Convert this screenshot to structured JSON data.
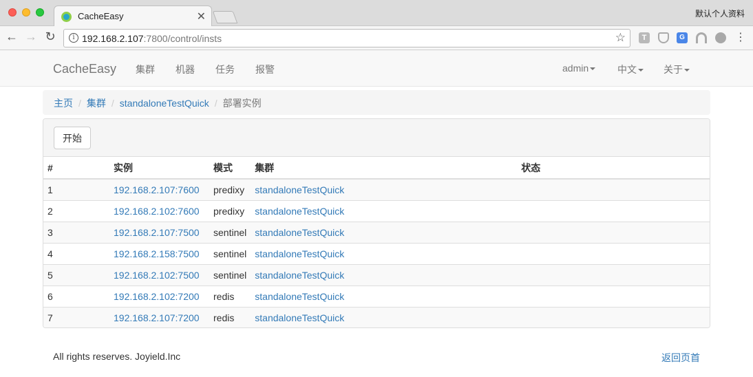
{
  "browser": {
    "tab_title": "CacheEasy",
    "tab_close": "✕",
    "profile": "默认个人资料",
    "url_host": "192.168.2.107",
    "url_rest": ":7800/control/insts"
  },
  "navbar": {
    "brand": "CacheEasy",
    "menu": [
      "集群",
      "机器",
      "任务",
      "报警"
    ],
    "user": "admin",
    "language": "中文",
    "about": "关于"
  },
  "breadcrumb": {
    "home": "主页",
    "clusters": "集群",
    "cluster": "standaloneTestQuick",
    "current": "部署实例",
    "separator": "/"
  },
  "panel": {
    "start_label": "开始",
    "columns": [
      "#",
      "实例",
      "模式",
      "集群",
      "状态"
    ],
    "rows": [
      {
        "no": "1",
        "instance": "192.168.2.107:7600",
        "mode": "predixy",
        "cluster": "standaloneTestQuick",
        "status": ""
      },
      {
        "no": "2",
        "instance": "192.168.2.102:7600",
        "mode": "predixy",
        "cluster": "standaloneTestQuick",
        "status": ""
      },
      {
        "no": "3",
        "instance": "192.168.2.107:7500",
        "mode": "sentinel",
        "cluster": "standaloneTestQuick",
        "status": ""
      },
      {
        "no": "4",
        "instance": "192.168.2.158:7500",
        "mode": "sentinel",
        "cluster": "standaloneTestQuick",
        "status": ""
      },
      {
        "no": "5",
        "instance": "192.168.2.102:7500",
        "mode": "sentinel",
        "cluster": "standaloneTestQuick",
        "status": ""
      },
      {
        "no": "6",
        "instance": "192.168.2.102:7200",
        "mode": "redis",
        "cluster": "standaloneTestQuick",
        "status": ""
      },
      {
        "no": "7",
        "instance": "192.168.2.107:7200",
        "mode": "redis",
        "cluster": "standaloneTestQuick",
        "status": ""
      }
    ]
  },
  "footer": {
    "copyright": "All rights reserves. Joyield.Inc",
    "back_to_top": "返回页首"
  }
}
